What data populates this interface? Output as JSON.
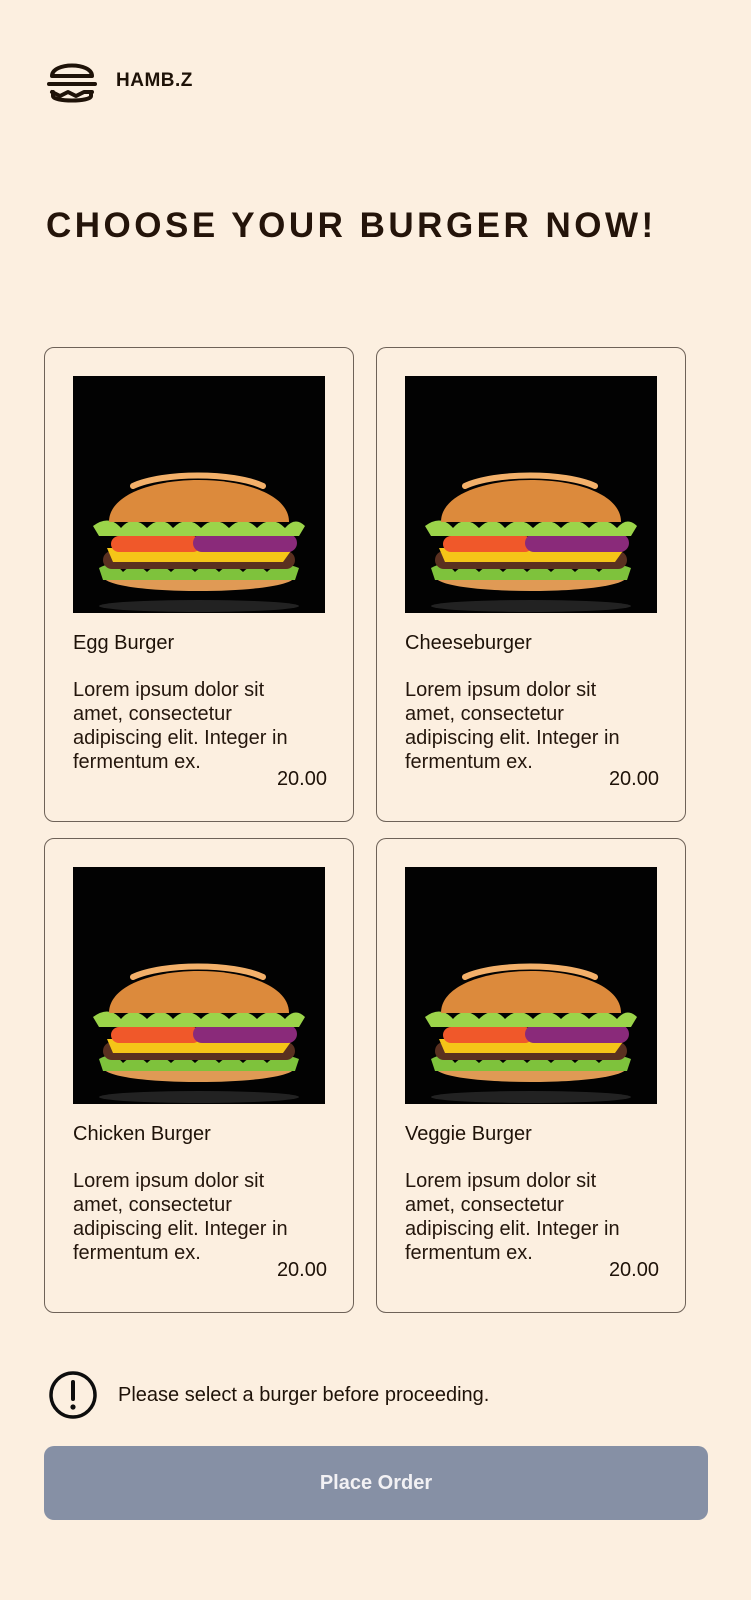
{
  "brand": {
    "name": "HAMB.Z",
    "logo_icon": "burger-icon"
  },
  "page": {
    "title": "CHOOSE YOUR BURGER NOW!"
  },
  "menu": {
    "items": [
      {
        "name": "Egg Burger",
        "description": "Lorem ipsum dolor sit amet, consectetur adipiscing elit. Integer in fermentum ex.",
        "price": "20.00",
        "image": "burger-photo"
      },
      {
        "name": "Cheeseburger",
        "description": "Lorem ipsum dolor sit amet, consectetur adipiscing elit. Integer in fermentum ex.",
        "price": "20.00",
        "image": "burger-photo"
      },
      {
        "name": "Chicken Burger",
        "description": "Lorem ipsum dolor sit amet, consectetur adipiscing elit. Integer in fermentum ex.",
        "price": "20.00",
        "image": "burger-photo"
      },
      {
        "name": "Veggie Burger",
        "description": "Lorem ipsum dolor sit amet, consectetur adipiscing elit. Integer in fermentum ex.",
        "price": "20.00",
        "image": "burger-photo"
      }
    ]
  },
  "notice": {
    "icon": "alert-circle-icon",
    "text": "Please select a burger before proceeding."
  },
  "order": {
    "button_label": "Place Order"
  },
  "colors": {
    "background": "#fcefe0",
    "text": "#1e1208",
    "card_border": "#6e6258",
    "button_disabled": "#8690a5",
    "button_text": "#f2f1f4"
  }
}
